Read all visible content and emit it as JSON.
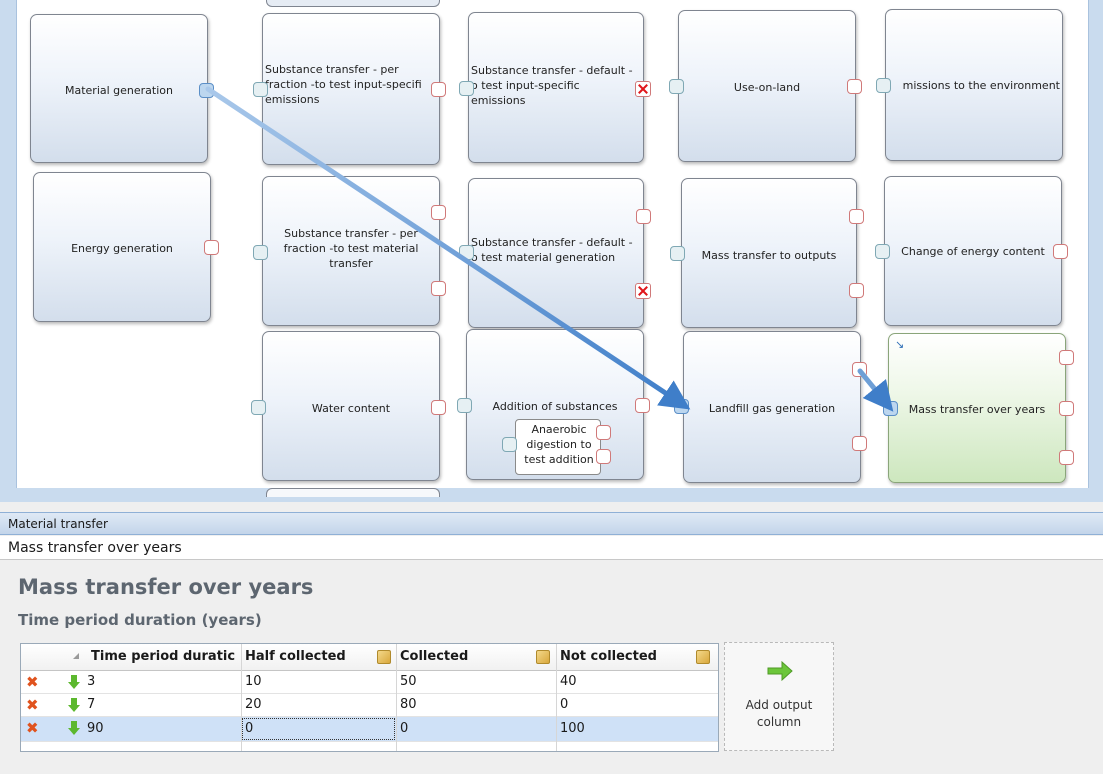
{
  "nodes": {
    "material_generation": {
      "label": "Material generation"
    },
    "energy_generation": {
      "label": "Energy generation"
    },
    "substance_per_fraction_input": {
      "label": "Substance transfer - per\nfraction -to test input-specifi\nemissions"
    },
    "substance_per_fraction_material": {
      "label": "Substance transfer - per\nfraction -to test material\ntransfer"
    },
    "water_content": {
      "label": "Water content"
    },
    "substance_default_input": {
      "label": "Substance transfer - default -\no test input-specific\nemissions"
    },
    "substance_default_material": {
      "label": "Substance transfer - default -\no test material generation"
    },
    "addition_of_substances": {
      "label": "Addition of substances"
    },
    "anaerobic_digestion": {
      "label": "Anaerobic\ndigestion to\ntest addition"
    },
    "use_on_land": {
      "label": "Use-on-land"
    },
    "mass_transfer_outputs": {
      "label": "Mass transfer to outputs"
    },
    "landfill_gas_generation": {
      "label": "Landfill gas generation"
    },
    "emissions_environment": {
      "label": "missions to the environment"
    },
    "change_energy_content": {
      "label": "Change of energy content"
    },
    "mass_transfer_years": {
      "label": "Mass transfer over years"
    }
  },
  "panel": {
    "header": "Material transfer",
    "name_field": "Mass transfer over years",
    "heading": "Mass transfer over years",
    "subheading": "Time period duration (years)",
    "columns": [
      "Time period duratic",
      "Half collected",
      "Collected",
      "Not collected"
    ],
    "rows": [
      {
        "cells": [
          "3",
          "10",
          "50",
          "40"
        ]
      },
      {
        "cells": [
          "7",
          "20",
          "80",
          "0"
        ]
      },
      {
        "cells": [
          "90",
          "0",
          "0",
          "100"
        ]
      }
    ],
    "add_output": "Add output\ncolumn"
  },
  "colors": {
    "accent": "#3f7ec9",
    "selected_node": "#cde7be",
    "delete_icon": "#e0531e",
    "move_icon": "#5cb82e"
  },
  "icons": [
    "delete-row-icon",
    "move-down-icon",
    "edit-column-icon",
    "add-column-arrow-icon",
    "remove-port-icon"
  ]
}
